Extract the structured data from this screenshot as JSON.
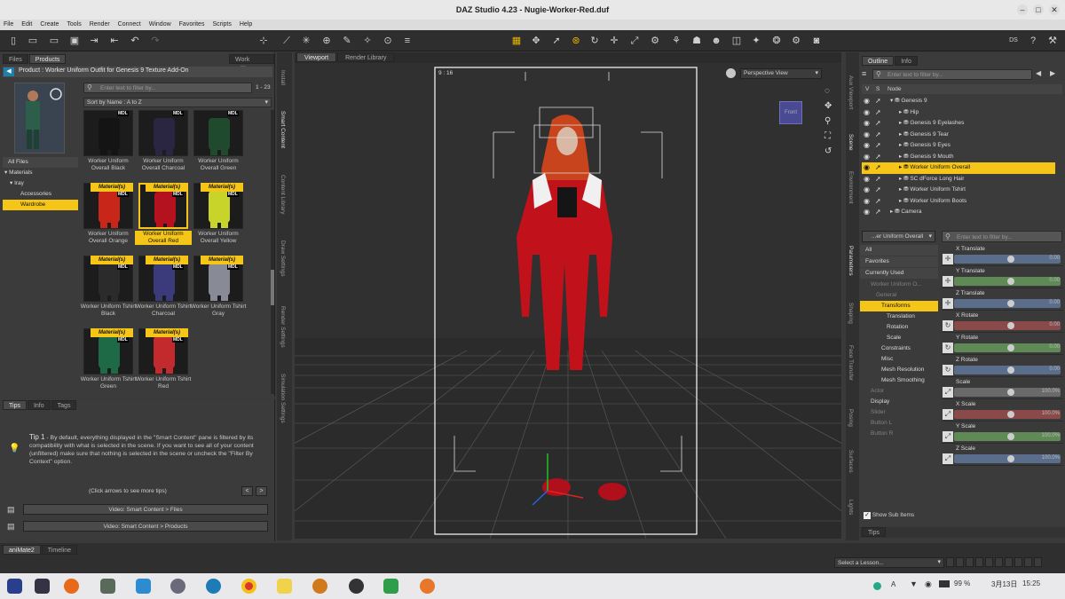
{
  "window": {
    "title": "DAZ Studio 4.23 - Nugie-Worker-Red.duf"
  },
  "menu": [
    "File",
    "Edit",
    "Create",
    "Tools",
    "Render",
    "Connect",
    "Window",
    "Favorites",
    "Scripts",
    "Help"
  ],
  "left": {
    "tabs": [
      "Files",
      "Products"
    ],
    "work_offline": "Work Offline",
    "product_title": "Product : Worker Uniform Outfit for Genesis 9 Texture Add-On",
    "filter_placeholder": "Enter text to filter by...",
    "count": "1 - 23",
    "sort": "Sort by Name : A to Z",
    "categories": [
      "All Files",
      "Materials",
      "Iray",
      "Accessories",
      "Wardrobe"
    ],
    "items": [
      {
        "label": "Worker Uniform Overall Black",
        "badge": "",
        "color": "#141414"
      },
      {
        "label": "Worker Uniform Overall Charcoal",
        "badge": "",
        "color": "#2a2540"
      },
      {
        "label": "Worker Uniform Overall Green",
        "badge": "",
        "color": "#1f4a2d"
      },
      {
        "label": "Worker Uniform Overall Orange",
        "badge": "Material(s)",
        "color": "#c9261a"
      },
      {
        "label": "Worker Uniform Overall Red",
        "badge": "Material(s)",
        "color": "#b3121e",
        "selected": true
      },
      {
        "label": "Worker Uniform Overall Yellow",
        "badge": "Material(s)",
        "color": "#c8d42a"
      },
      {
        "label": "Worker Uniform Tshirt Black",
        "badge": "Material(s)",
        "color": "#2b2b2b"
      },
      {
        "label": "Worker Uniform Tshirt Charcoal",
        "badge": "Material(s)",
        "color": "#3b3a7a"
      },
      {
        "label": "Worker Uniform Tshirt Gray",
        "badge": "Material(s)",
        "color": "#888a96"
      },
      {
        "label": "Worker Uniform Tshirt Green",
        "badge": "Material(s)",
        "color": "#1f6a46"
      },
      {
        "label": "Worker Uniform Tshirt Red",
        "badge": "Material(s)",
        "color": "#c22a2e"
      }
    ],
    "mdl": "MDL",
    "tips_tabs": [
      "Tips",
      "Info",
      "Tags"
    ],
    "tip_title": "Tip 1",
    "tip_text": " - By default, everything displayed in the \"Smart Content\" pane is filtered by its compatibility with what is selected in the scene. If you want to see all of your content (unfiltered) make sure that nothing is selected in the scene or uncheck the \"Filter By Context\" option.",
    "tip_nav": "(Click arrows to see more tips)",
    "videos": [
      "Video: Smart Content > Files",
      "Video: Smart Content > Products"
    ]
  },
  "side_tabs_left": [
    "Install",
    "Smart Content",
    "Content Library",
    "Draw Settings",
    "Render Settings",
    "Simulation Settings"
  ],
  "viewport": {
    "tabs": [
      "Viewport",
      "Render Library"
    ],
    "camera": "Perspective View",
    "ratio": "9 : 16",
    "cube_label": "Front"
  },
  "scene": {
    "tabs": [
      "Outline",
      "Info"
    ],
    "filter_placeholder": "Enter text to filter by...",
    "col_v": "V",
    "col_s": "S",
    "col_node": "Node",
    "nodes": [
      "Genesis 9",
      "Hip",
      "Genesis 9 Eyelashes",
      "Genesis 9 Tear",
      "Genesis 9 Eyes",
      "Genesis 9 Mouth",
      "Worker Uniform Overall",
      "SC dForce Long Hair",
      "Worker Uniform Tshirt",
      "Worker Uniform Boots",
      "Camera"
    ],
    "selected": "Worker Uniform Overall"
  },
  "side_tabs_right": [
    "Aux Viewport",
    "Scene",
    "Environment",
    "Parameters",
    "Shaping",
    "Face Transfer",
    "Posing",
    "Surfaces",
    "Lights"
  ],
  "params": {
    "node_select": "...er Uniform Overall",
    "filter_placeholder": "Enter text to filter by...",
    "tree": [
      "All",
      "Favorites",
      "Currently Used",
      "Worker Uniform O...",
      "General",
      "Transforms",
      "Translation",
      "Rotation",
      "Scale",
      "Constraints",
      "Misc",
      "Mesh Resolution",
      "Mesh Smoothing",
      "Actor",
      "Display",
      "Slider",
      "Button L",
      "Button R"
    ],
    "selected": "Transforms",
    "sliders": [
      {
        "name": "X Translate",
        "value": "0.00",
        "color": "#5a6e8c"
      },
      {
        "name": "Y Translate",
        "value": "0.00",
        "color": "#5f8a55"
      },
      {
        "name": "Z Translate",
        "value": "0.00",
        "color": "#5a6e8c"
      },
      {
        "name": "X Rotate",
        "value": "0.00",
        "color": "#8a4a4a"
      },
      {
        "name": "Y Rotate",
        "value": "0.00",
        "color": "#5f8a55"
      },
      {
        "name": "Z Rotate",
        "value": "0.00",
        "color": "#5a6e8c"
      },
      {
        "name": "Scale",
        "value": "100.0%",
        "color": "#6a6a6a"
      },
      {
        "name": "X Scale",
        "value": "100.0%",
        "color": "#8a4a4a"
      },
      {
        "name": "Y Scale",
        "value": "100.0%",
        "color": "#5f8a55"
      },
      {
        "name": "Z Scale",
        "value": "100.0%",
        "color": "#5a6e8c"
      }
    ],
    "show_sub": "Show Sub Items"
  },
  "bottom": {
    "tabs": [
      "aniMate2",
      "Timeline"
    ],
    "tips_tab": "Tips",
    "lesson": "Select a Lesson..."
  },
  "taskbar": {
    "battery": "99 %",
    "date": "3月13日",
    "time": "15:25",
    "ime": "A"
  }
}
